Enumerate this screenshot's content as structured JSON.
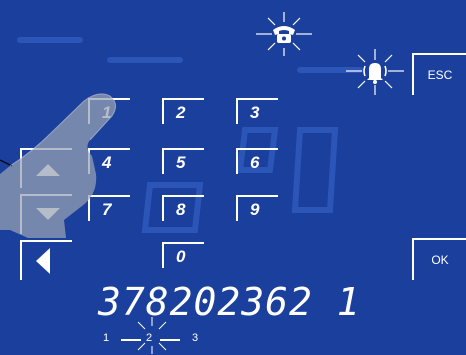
{
  "keypad": {
    "keys": [
      "1",
      "2",
      "3",
      "4",
      "5",
      "6",
      "7",
      "8",
      "9",
      "0"
    ]
  },
  "buttons": {
    "esc_label": "ESC",
    "ok_label": "OK"
  },
  "display": {
    "number": "378202362 1"
  },
  "pages": {
    "labels": [
      "1",
      "2",
      "3"
    ],
    "current": "2"
  },
  "icons": {
    "phone": "phone-icon",
    "alarm": "alarm-bell-icon",
    "up": "arrow-up-icon",
    "down": "arrow-down-icon",
    "back": "arrow-left-icon",
    "hand": "pointing-hand-icon"
  },
  "colors": {
    "background": "#1a3f9c",
    "foreground": "#ffffff"
  }
}
